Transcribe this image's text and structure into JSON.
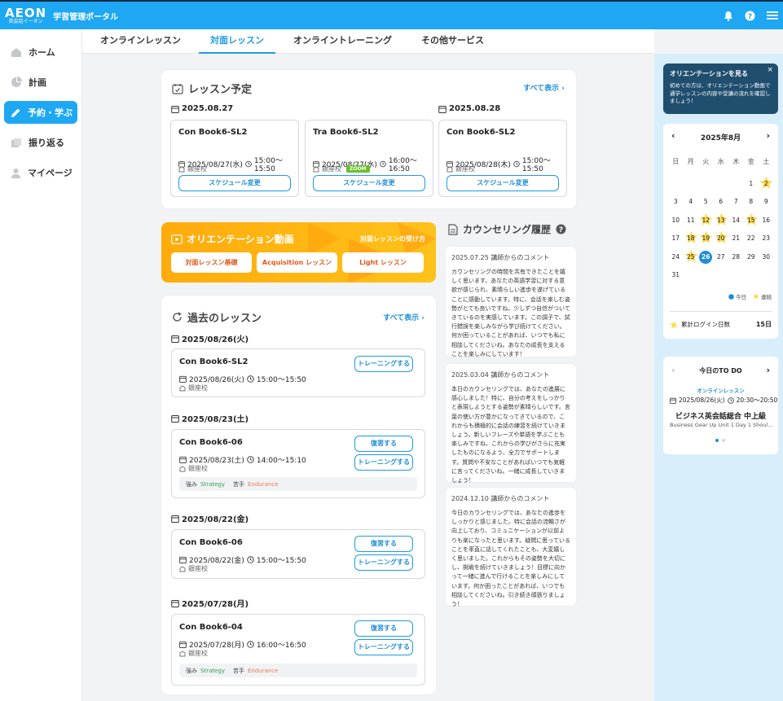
{
  "header": {
    "brand": "AEON",
    "brand_sub": "英会話イーオン",
    "portal_title": "学習管理ポータル"
  },
  "sidebar": {
    "items": [
      {
        "label": "ホーム",
        "icon": "home-icon"
      },
      {
        "label": "計画",
        "icon": "chart-icon"
      },
      {
        "label": "予約・学ぶ",
        "icon": "pencil-icon",
        "active": true
      },
      {
        "label": "振り返る",
        "icon": "cards-icon"
      },
      {
        "label": "マイページ",
        "icon": "user-icon"
      }
    ]
  },
  "tabs": [
    "オンラインレッスン",
    "対面レッスン",
    "オンライントレーニング",
    "その他サービス"
  ],
  "schedule": {
    "title": "レッスン予定",
    "see_all": "すべて表示",
    "dates": [
      "2025.08.27",
      "2025.08.28"
    ],
    "lessons": [
      {
        "name": "Con Book6-SL2",
        "date": "2025/08/27(水)",
        "time": "15:00～15:50",
        "school": "銀座校",
        "zoom": "",
        "button": "スケジュール変更"
      },
      {
        "name": "Tra Book6-SL2",
        "date": "2025/08/27(水)",
        "time": "16:00～16:50",
        "school": "銀座校",
        "zoom": "ZOOM",
        "button": "スケジュール変更"
      },
      {
        "name": "Con Book6-SL2",
        "date": "2025/08/28(木)",
        "time": "15:00～15:50",
        "school": "銀座校",
        "zoom": "",
        "button": "スケジュール変更"
      }
    ]
  },
  "orientation": {
    "title": "オリエンテーション動画",
    "how_to": "対面レッスンの受け方",
    "buttons": [
      "対面レッスン基礎",
      "Acquisition レッスン",
      "Light レッスン"
    ]
  },
  "past": {
    "title": "過去のレッスン",
    "see_all": "すべて表示",
    "groups": [
      {
        "date": "2025/08/26(火)",
        "name": "Con Book6-SL2",
        "meta_date": "2025/08/26(火)",
        "time": "15:00～15:50",
        "school": "銀座校",
        "review": "",
        "training": "トレーニングする",
        "strength_label": "",
        "strength": "",
        "weak_label": "",
        "weak": ""
      },
      {
        "date": "2025/08/23(土)",
        "name": "Con Book6-06",
        "meta_date": "2025/08/23(土)",
        "time": "14:00～15:10",
        "school": "銀座校",
        "review": "復習する",
        "training": "トレーニングする",
        "strength_label": "強み",
        "strength": "Strategy",
        "weak_label": "苦手",
        "weak": "Endurance"
      },
      {
        "date": "2025/08/22(金)",
        "name": "Con Book6-06",
        "meta_date": "2025/08/22(金)",
        "time": "15:00～15:50",
        "school": "銀座校",
        "review": "復習する",
        "training": "トレーニングする",
        "strength_label": "",
        "strength": "",
        "weak_label": "",
        "weak": ""
      },
      {
        "date": "2025/07/28(月)",
        "name": "Con Book6-04",
        "meta_date": "2025/07/28(月)",
        "time": "16:00～16:50",
        "school": "銀座校",
        "review": "復習する",
        "training": "トレーニングする",
        "strength_label": "強み",
        "strength": "Strategy",
        "weak_label": "苦手",
        "weak": "Endurance"
      }
    ]
  },
  "counseling": {
    "title": "カウンセリング履歴",
    "entries": [
      {
        "head": "2025.07.25  講師からのコメント",
        "body": "カウンセリングの時間を共有できたことを嬉しく思います。あなたの英語学習に対する意欲が感じられ、素晴らしい進歩を遂げていることに感動しています。特に、会話を楽しむ姿勢がとても良いですね。少しずつ自信がついてきているのを実感しています。この調子で、試行錯誤を楽しみながら学び続けてください。何か困っていることがあれば、いつでも私に相談してくださいね。あなたの成長を支えることを楽しみにしています！"
      },
      {
        "head": "2025.03.04  講師からのコメント",
        "body": "本日のカウンセリングでは、あなたの進展に感心しました！特に、自分の考えをしっかりと表現しようとする姿勢が素晴らしいです。言葉の使い方が豊かになってきているので、これからも積極的に会話の練習を続けていきましょう。新しいフレーズや単語を学ぶことも楽しみですね。これからの学びがさらに充実したものになるよう、全力でサポートします。質問や不安なことがあればいつでも気軽に言ってくださいね。一緒に成長していきましょう！"
      },
      {
        "head": "2024.12.10  講師からのコメント",
        "body": "今日のカウンセリングでは、あなたの進歩をしっかりと感じました。特に会話の流暢さが向上しており、コミュニケーションが以前よりも楽になったと思います。疑問に思っていることを率直に話してくれたことも、大変嬉しく思いました。これからもその姿勢を大切にし、挑戦を続けていきましょう！目標に向かって一緒に進んで行けることを楽しみにしています。何か困ったことがあれば、いつでも相談してくださいね。引き続き頑張りましょう！"
      }
    ]
  },
  "tip": {
    "title": "オリエンテーションを見る",
    "body": "初めての方は、オリエンテーション動画で通学レッスンの内容や受講の流れを確認しましょう！",
    "close": "×"
  },
  "calendar": {
    "month": "2025年8月",
    "weekdays": [
      "日",
      "月",
      "火",
      "水",
      "木",
      "金",
      "土"
    ],
    "weeks": [
      [
        "",
        "",
        "",
        "",
        "",
        "1",
        "2"
      ],
      [
        "3",
        "4",
        "5",
        "6",
        "7",
        "8",
        "9"
      ],
      [
        "10",
        "11",
        "12",
        "13",
        "14",
        "15",
        "16"
      ],
      [
        "17",
        "18",
        "19",
        "20",
        "21",
        "22",
        "23"
      ],
      [
        "24",
        "25",
        "26",
        "27",
        "28",
        "29",
        "30"
      ],
      [
        "31",
        "",
        "",
        "",
        "",
        "",
        ""
      ]
    ],
    "starred_days": [
      "2",
      "12",
      "13",
      "15",
      "18",
      "19",
      "20",
      "25"
    ],
    "today": "26",
    "legend_today": "今日",
    "legend_streak": "連続",
    "total_label": "累計ログイン日数",
    "total_value": "15日",
    "star_color": "#ffd84a",
    "today_color": "#1e8fd6"
  },
  "todo": {
    "title": "今日のTO DO",
    "category": "オンラインレッスン",
    "datetime": "2025/08/26(火)",
    "time": "20:30～20:50",
    "course": "ビジネス英会話総合 中上級",
    "detail": "Business Gear Up Unit 1 Day 1 Should…"
  }
}
